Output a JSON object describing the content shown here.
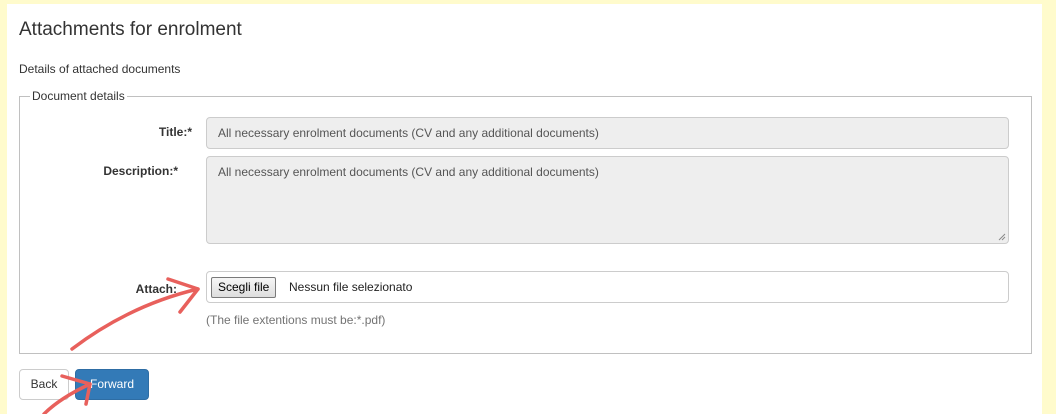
{
  "page": {
    "title": "Attachments for enrolment",
    "subtitle": "Details of attached documents"
  },
  "fieldset": {
    "legend": "Document details",
    "title_label": "Title:*",
    "title_value": "All necessary enrolment documents (CV and any additional documents)",
    "description_label": "Description:*",
    "description_value": "All necessary enrolment documents (CV and any additional documents)",
    "attach_label": "Attach:",
    "file_button_label": "Scegli file",
    "file_status": "Nessun file selezionato",
    "help_text": "(The file extentions must be:*.pdf)"
  },
  "actions": {
    "back_label": "Back",
    "forward_label": "Forward"
  },
  "colors": {
    "primary": "#337ab7",
    "frame": "#fffbcc",
    "annotation_arrow": "#e8605c"
  },
  "annotations": [
    "arrow-to-attach",
    "arrow-to-forward"
  ]
}
